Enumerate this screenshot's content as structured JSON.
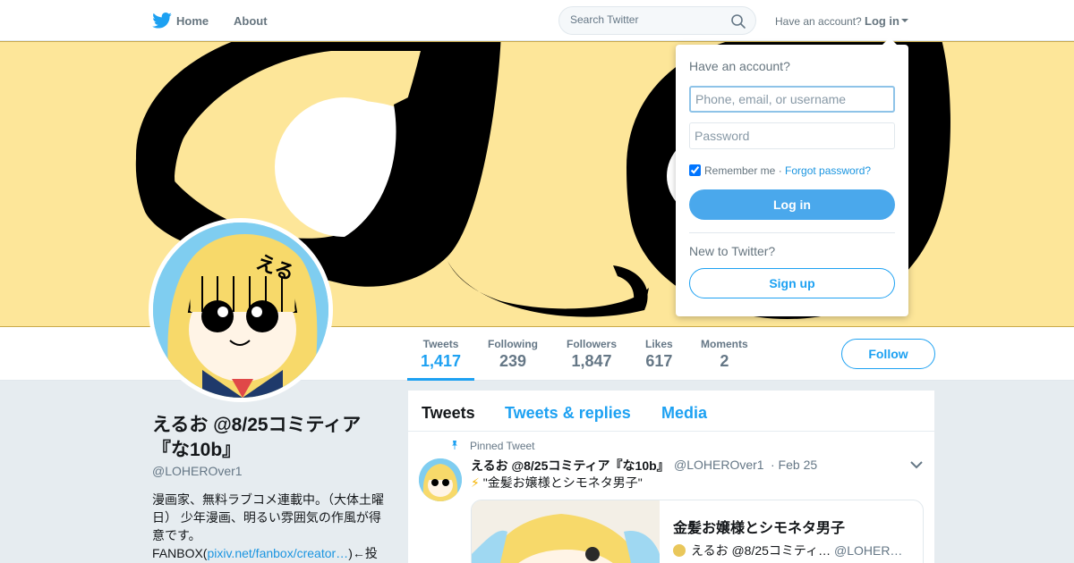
{
  "nav": {
    "home_label": "Home",
    "about_label": "About",
    "search_placeholder": "Search Twitter",
    "have_account_text": "Have an account?",
    "login_label": "Log in"
  },
  "profile": {
    "name": "えるお @8/25コミティア『な10b』",
    "handle": "@LOHEROver1",
    "bio_text": "漫画家、無料ラブコメ連載中。（大体土曜日） 少年漫画、明るい雰囲気の作風が得意です。",
    "bio_fanbox_prefix": "FANBOX(",
    "bio_link": "pixiv.net/fanbox/creator…",
    "bio_suffix": ")←投",
    "follow_label": "Follow"
  },
  "stats": [
    {
      "label": "Tweets",
      "value": "1,417",
      "active": true
    },
    {
      "label": "Following",
      "value": "239"
    },
    {
      "label": "Followers",
      "value": "1,847"
    },
    {
      "label": "Likes",
      "value": "617"
    },
    {
      "label": "Moments",
      "value": "2"
    }
  ],
  "timeline": {
    "tabs": [
      "Tweets",
      "Tweets & replies",
      "Media"
    ],
    "pinned_label": "Pinned Tweet",
    "tweet": {
      "name": "えるお @8/25コミティア『な10b』",
      "handle": "@LOHEROver1",
      "date": "· Feb 25",
      "bolt": "⚡",
      "text": "\"金髪お嬢様とシモネタ男子\"",
      "card_title": "金髪お嬢様とシモネタ男子",
      "card_author": "えるお @8/25コミティ…",
      "card_handle": "@LOHER…"
    }
  },
  "login_dropdown": {
    "heading": "Have an account?",
    "username_placeholder": "Phone, email, or username",
    "password_placeholder": "Password",
    "remember_label": "Remember me",
    "separator": " · ",
    "forgot_label": "Forgot password?",
    "login_button": "Log in",
    "new_label": "New to Twitter?",
    "signup_button": "Sign up"
  },
  "colors": {
    "accent": "#1da1f2",
    "banner": "#fde699",
    "background": "#e6ecf0"
  }
}
